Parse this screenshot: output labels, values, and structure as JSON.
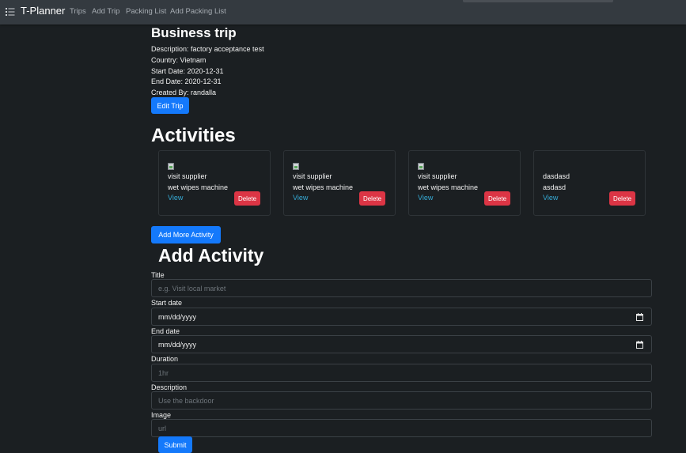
{
  "navbar": {
    "brand": "T-Planner",
    "links": [
      "Trips",
      "Add Trip",
      "Packing List",
      "Add Packing List"
    ]
  },
  "trip": {
    "title": "Business trip",
    "description": "Description: factory acceptance test",
    "country": "Country: Vietnam",
    "start_date": "Start Date: 2020-12-31",
    "end_date": "End Date: 2020-12-31",
    "created_by": "Created By: randalla",
    "edit_label": "Edit Trip"
  },
  "activities": {
    "heading": "Activities",
    "cards": [
      {
        "line1": "visit supplier",
        "line2": "wet wipes machine",
        "view": "View",
        "delete": "Delete"
      },
      {
        "line1": "visit supplier",
        "line2": "wet wipes machine",
        "view": "View",
        "delete": "Delete"
      },
      {
        "line1": "visit supplier",
        "line2": "wet wipes machine",
        "view": "View",
        "delete": "Delete"
      },
      {
        "line1": "dasdasd",
        "line2": "asdasd",
        "view": "View",
        "delete": "Delete"
      }
    ],
    "add_more_label": "Add More Activity"
  },
  "form": {
    "heading": "Add Activity",
    "title_label": "Title",
    "title_placeholder": "e.g. Visit local market",
    "start_label": "Start date",
    "start_value": "mm/dd/yyyy",
    "end_label": "End date",
    "end_value": "mm/dd/yyyy",
    "duration_label": "Duration",
    "duration_placeholder": "1hr",
    "description_label": "Description",
    "description_placeholder": "Use the backdoor",
    "image_label": "Image",
    "image_placeholder": "url",
    "submit_label": "Submit"
  },
  "colors": {
    "background": "#1b1f22",
    "navbar": "#343a40",
    "primary": "#1479fb",
    "danger": "#dc3545",
    "link": "#35a9d4"
  },
  "icons": {
    "brand": "list-icon",
    "date_picker": "calendar-icon"
  }
}
